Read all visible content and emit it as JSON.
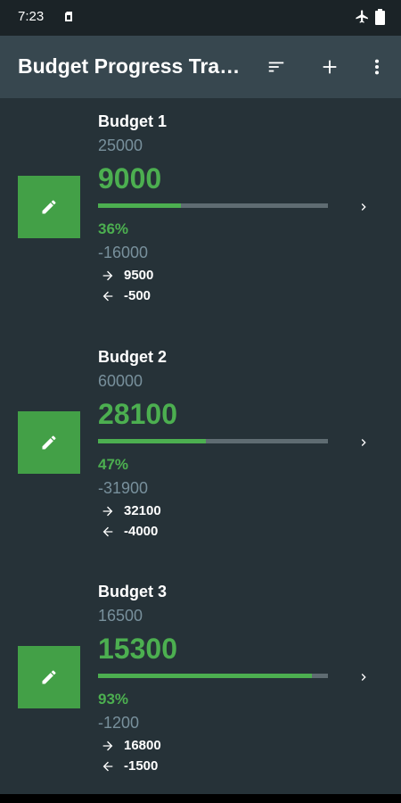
{
  "status_bar": {
    "time": "7:23",
    "icons": [
      "sim-card-icon",
      "airplane-mode-icon",
      "battery-icon"
    ]
  },
  "app_bar": {
    "title": "Budget Progress Tracker",
    "actions": [
      "sort-icon",
      "add-icon",
      "more-vert-icon"
    ]
  },
  "colors": {
    "accent": "#4caf50",
    "edit_button": "#43a047",
    "background": "#263238",
    "app_bar": "#37474f",
    "muted_text": "#78909c"
  },
  "budgets": [
    {
      "name": "Budget 1",
      "total": "25000",
      "spent": "9000",
      "progress": 0.36,
      "percent": "36%",
      "remaining": "-16000",
      "incoming": "9500",
      "outgoing": "-500"
    },
    {
      "name": "Budget 2",
      "total": "60000",
      "spent": "28100",
      "progress": 0.47,
      "percent": "47%",
      "remaining": "-31900",
      "incoming": "32100",
      "outgoing": "-4000"
    },
    {
      "name": "Budget 3",
      "total": "16500",
      "spent": "15300",
      "progress": 0.93,
      "percent": "93%",
      "remaining": "-1200",
      "incoming": "16800",
      "outgoing": "-1500"
    }
  ]
}
